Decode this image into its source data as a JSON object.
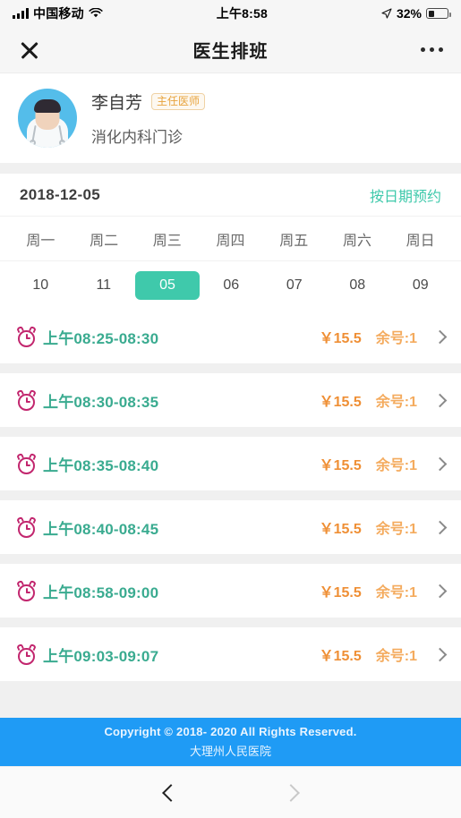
{
  "status_bar": {
    "carrier": "中国移动",
    "time": "上午8:58",
    "battery_percent": "32%",
    "battery_level": 32,
    "signal_icon": "signal-bars-icon",
    "wifi_icon": "wifi-icon",
    "location_icon": "location-arrow-icon",
    "battery_icon": "battery-icon"
  },
  "navbar": {
    "close_icon": "close-icon",
    "title": "医生排班",
    "more_icon": "more-options-icon"
  },
  "doctor": {
    "avatar_icon": "doctor-avatar",
    "name": "李自芳",
    "title_badge": "主任医师",
    "department": "消化内科门诊",
    "badge_color": "#e8a33d"
  },
  "date_section": {
    "current_date": "2018-12-05",
    "book_by_date_link": "按日期预约",
    "accent_color": "#3fc9ab",
    "weekdays": [
      "周一",
      "周二",
      "周三",
      "周四",
      "周五",
      "周六",
      "周日"
    ],
    "days": [
      {
        "num": "10",
        "selected": false
      },
      {
        "num": "11",
        "selected": false
      },
      {
        "num": "05",
        "selected": true
      },
      {
        "num": "06",
        "selected": false
      },
      {
        "num": "07",
        "selected": false
      },
      {
        "num": "08",
        "selected": false
      },
      {
        "num": "09",
        "selected": false
      }
    ]
  },
  "slots": [
    {
      "clock_icon": "alarm-clock-icon",
      "time": "上午08:25-08:30",
      "price": "￥15.5",
      "remaining": "余号:1",
      "chevron_icon": "chevron-right-icon"
    },
    {
      "clock_icon": "alarm-clock-icon",
      "time": "上午08:30-08:35",
      "price": "￥15.5",
      "remaining": "余号:1",
      "chevron_icon": "chevron-right-icon"
    },
    {
      "clock_icon": "alarm-clock-icon",
      "time": "上午08:35-08:40",
      "price": "￥15.5",
      "remaining": "余号:1",
      "chevron_icon": "chevron-right-icon"
    },
    {
      "clock_icon": "alarm-clock-icon",
      "time": "上午08:40-08:45",
      "price": "￥15.5",
      "remaining": "余号:1",
      "chevron_icon": "chevron-right-icon"
    },
    {
      "clock_icon": "alarm-clock-icon",
      "time": "上午08:58-09:00",
      "price": "￥15.5",
      "remaining": "余号:1",
      "chevron_icon": "chevron-right-icon"
    },
    {
      "clock_icon": "alarm-clock-icon",
      "time": "上午09:03-09:07",
      "price": "￥15.5",
      "remaining": "余号:1",
      "chevron_icon": "chevron-right-icon"
    }
  ],
  "footer": {
    "copyright": "Copyright © 2018- 2020 All Rights Reserved.",
    "hospital": "大理州人民医院",
    "background_color": "#1f9bf5"
  },
  "bottom_bar": {
    "back_icon": "chevron-left-icon",
    "forward_icon": "chevron-right-icon"
  }
}
